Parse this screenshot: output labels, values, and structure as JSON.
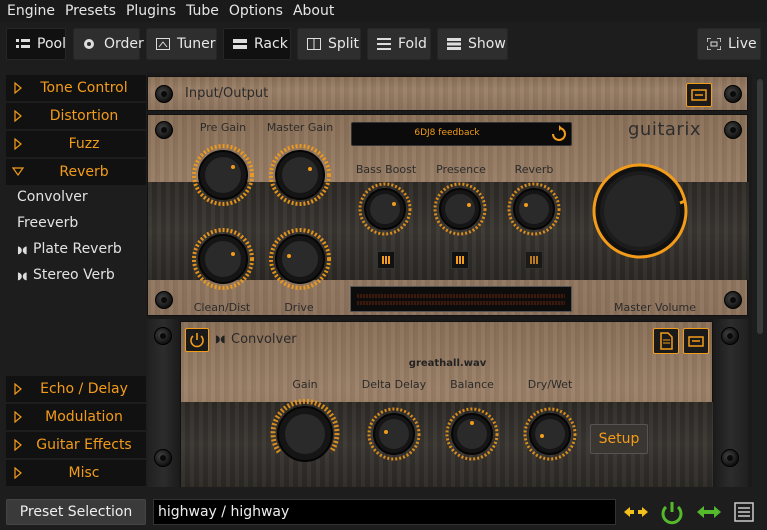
{
  "menu": [
    "Engine",
    "Presets",
    "Plugins",
    "Tube",
    "Options",
    "About"
  ],
  "toolbar": {
    "pool": "Pool",
    "order": "Order",
    "tuner": "Tuner",
    "rack": "Rack",
    "split": "Split",
    "fold": "Fold",
    "show": "Show",
    "live": "Live"
  },
  "categories": {
    "tone_control": "Tone Control",
    "distortion": "Distortion",
    "fuzz": "Fuzz",
    "reverb": "Reverb",
    "echo_delay": "Echo / Delay",
    "modulation": "Modulation",
    "guitar_effects": "Guitar Effects",
    "misc": "Misc"
  },
  "reverb_plugins": [
    "Convolver",
    "Freeverb",
    "Plate Reverb",
    "Stereo Verb"
  ],
  "rack": {
    "io_label": "Input/Output",
    "amp": {
      "preset_name": "6DJ8 feedback",
      "brand": "guitarix",
      "knobs": {
        "pre_gain": "Pre Gain",
        "master_gain": "Master Gain",
        "bass_boost": "Bass Boost",
        "presence": "Presence",
        "reverb": "Reverb",
        "clean_dist": "Clean/Dist",
        "drive": "Drive",
        "master_volume": "Master Volume"
      }
    },
    "convolver": {
      "name": "Convolver",
      "file": "greathall.wav",
      "knobs": {
        "gain": "Gain",
        "delta_delay": "Delta Delay",
        "balance": "Balance",
        "dry_wet": "Dry/Wet"
      },
      "setup": "Setup"
    }
  },
  "bottom": {
    "preset_selection": "Preset Selection",
    "current_preset": "highway / highway"
  },
  "colors": {
    "accent": "#f39c1a",
    "background": "#1d1d1d"
  }
}
